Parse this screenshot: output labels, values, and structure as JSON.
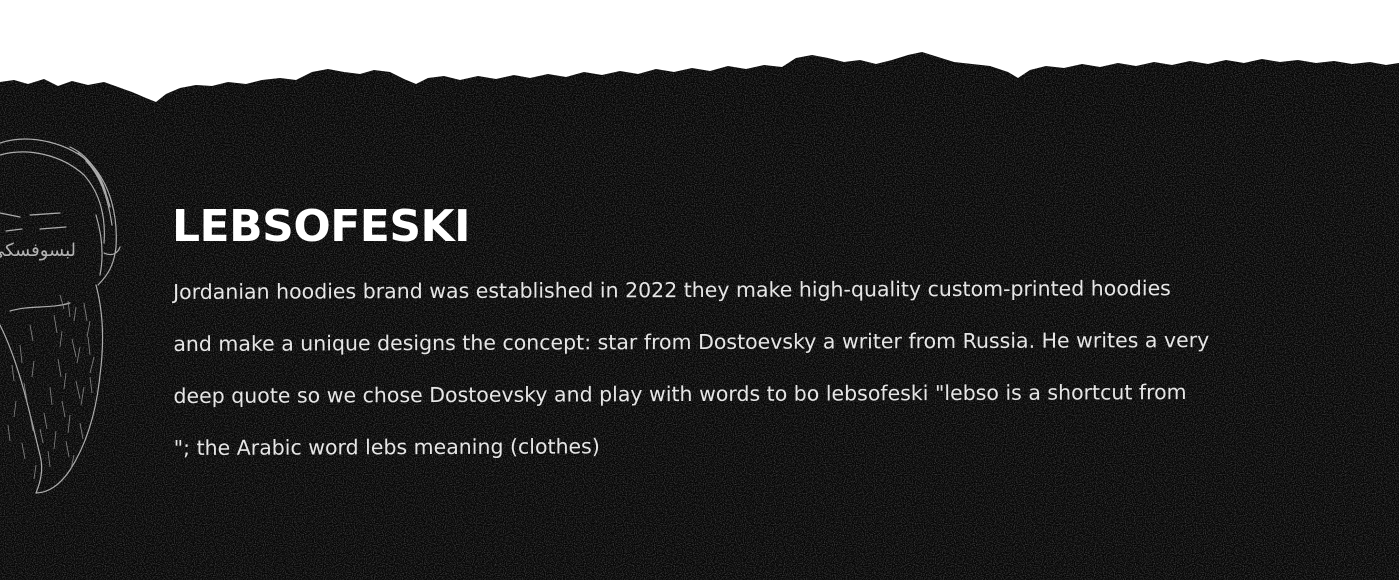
{
  "colors": {
    "background_top": "#ffffff",
    "banner_background": "#050505",
    "title_text": "#ffffff",
    "body_text": "#e6e6e6"
  },
  "banner": {
    "title": "LEBSOFESKI",
    "description_lines": [
      "Jordanian hoodies brand was established in 2022 they make high-quality custom-printed hoodies",
      "and make a unique designs the concept: star from  Dostoevsky a writer from Russia.  He writes a very",
      "deep quote so we chose Dostoevsky and play with words to bo lebsofeski \"lebso is a shortcut from",
      "\"; the Arabic word lebs meaning (clothes)"
    ],
    "portrait": {
      "icon": "dostoevsky-portrait-illustration",
      "caption": "لبسوفسكي"
    }
  }
}
